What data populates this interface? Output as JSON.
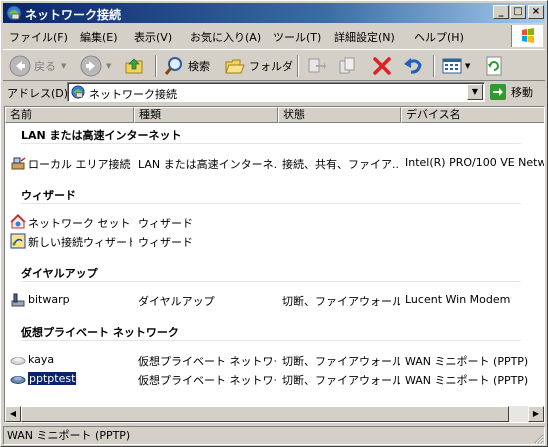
{
  "window": {
    "title": "ネットワーク接続",
    "buttons": {
      "minimize": "_",
      "maximize": "□",
      "close": "×"
    }
  },
  "menu": [
    "ファイル(F)",
    "編集(E)",
    "表示(V)",
    "お気に入り(A)",
    "ツール(T)",
    "詳細設定(N)",
    "ヘルプ(H)"
  ],
  "toolbar": {
    "back_label": "戻る",
    "search_label": "検索",
    "folders_label": "フォルダ",
    "icons": [
      "back-arrow-icon",
      "forward-arrow-icon",
      "up-folder-icon",
      "search-icon",
      "folders-icon",
      "move-to-icon",
      "copy-to-icon",
      "delete-icon",
      "undo-icon",
      "views-icon",
      "refresh-icon"
    ]
  },
  "address": {
    "label": "アドレス(D)",
    "value": "ネットワーク接続",
    "go_label": "移動"
  },
  "columns": [
    "名前",
    "種類",
    "状態",
    "デバイス名"
  ],
  "groups": [
    {
      "title": "LAN または高速インターネット",
      "items": [
        {
          "name": "ローカル エリア接続",
          "type": "LAN または高速インターネ...",
          "status": "接続、共有、ファイア...",
          "device": "Intel(R) PRO/100 VE Netw",
          "icon": "lan-connection-icon"
        }
      ]
    },
    {
      "title": "ウィザード",
      "items": [
        {
          "name": "ネットワーク セットア...",
          "type": "ウィザード",
          "status": "",
          "device": "",
          "icon": "network-setup-wizard-icon"
        },
        {
          "name": "新しい接続ウィザード",
          "type": "ウィザード",
          "status": "",
          "device": "",
          "icon": "new-connection-wizard-icon"
        }
      ]
    },
    {
      "title": "ダイヤルアップ",
      "items": [
        {
          "name": "bitwarp",
          "type": "ダイヤルアップ",
          "status": "切断、ファイアウォール",
          "device": "Lucent Win Modem",
          "icon": "dialup-icon"
        }
      ]
    },
    {
      "title": "仮想プライベート ネットワーク",
      "items": [
        {
          "name": "kaya",
          "type": "仮想プライベート ネットワー...",
          "status": "切断、ファイアウォール",
          "device": "WAN ミニポート (PPTP)",
          "icon": "vpn-icon"
        },
        {
          "name": "pptptest",
          "type": "仮想プライベート ネットワー...",
          "status": "切断、ファイアウォール",
          "device": "WAN ミニポート (PPTP)",
          "icon": "vpn-icon",
          "selected": true
        }
      ]
    }
  ],
  "statusbar": {
    "text": "WAN ミニポート (PPTP)"
  }
}
